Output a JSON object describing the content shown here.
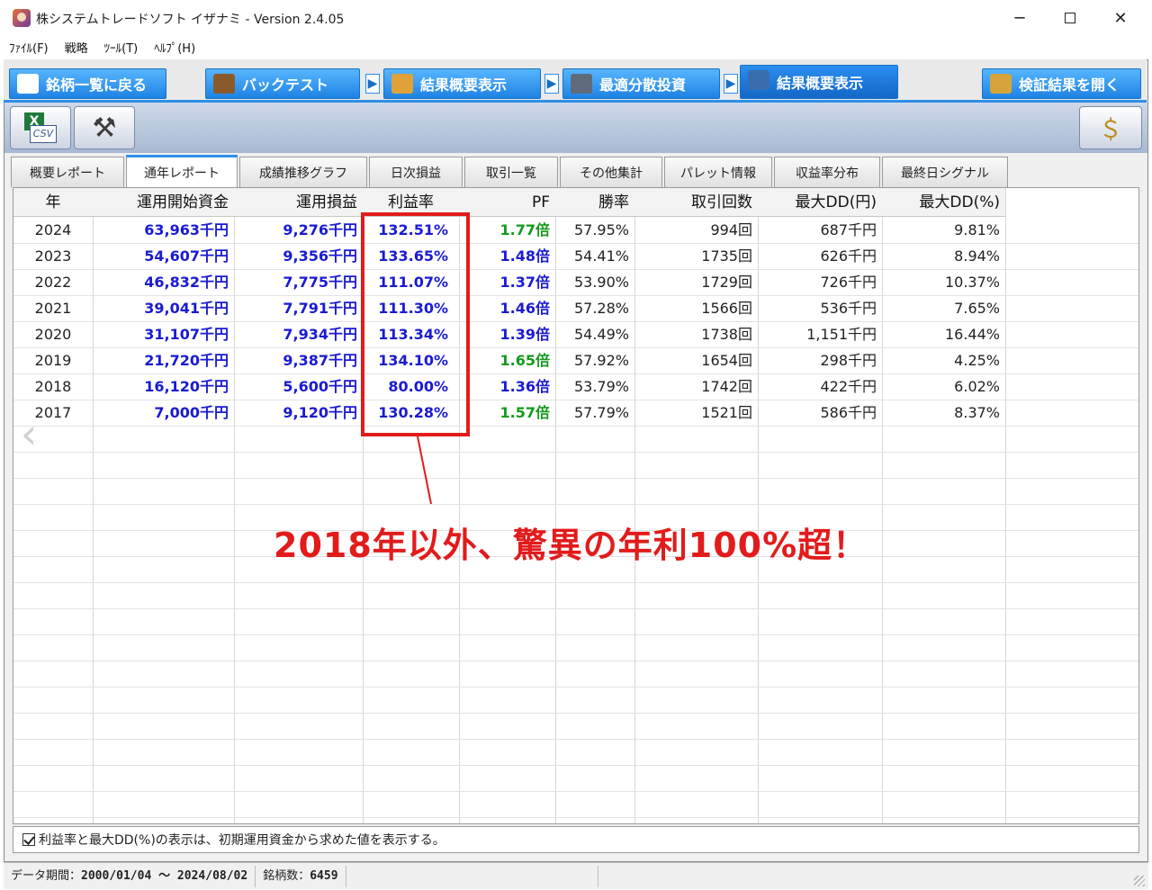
{
  "window": {
    "title": "株システムトレードソフト イザナミ - Version 2.4.05",
    "minimize": "─",
    "close": "✕"
  },
  "menu": [
    "ﾌｧｲﾙ(F)",
    "戦略",
    "ﾂｰﾙ(T)",
    "ﾍﾙﾌﾟ(H)"
  ],
  "nav": {
    "back_to_list": "銘柄一覧に戻る",
    "backtest": "バックテスト",
    "summary1": "結果概要表示",
    "optimal": "最適分散投資",
    "summary2": "結果概要表示",
    "open_results": "検証結果を開く"
  },
  "toolbar": {
    "csv_label": "CSV",
    "excel_label": "X"
  },
  "tabs": [
    "概要レポート",
    "通年レポート",
    "成績推移グラフ",
    "日次損益",
    "取引一覧",
    "その他集計",
    "パレット情報",
    "収益率分布",
    "最終日シグナル"
  ],
  "active_tab": "通年レポート",
  "table": {
    "headers": [
      "年",
      "運用開始資金",
      "運用損益",
      "利益率",
      "PF",
      "勝率",
      "取引回数",
      "最大DD(円)",
      "最大DD(%)"
    ],
    "rows": [
      [
        "2024",
        "63,963千円",
        "9,276千円",
        "132.51%",
        "1.77倍",
        "57.95%",
        "994回",
        "687千円",
        "9.81%"
      ],
      [
        "2023",
        "54,607千円",
        "9,356千円",
        "133.65%",
        "1.48倍",
        "54.41%",
        "1735回",
        "626千円",
        "8.94%"
      ],
      [
        "2022",
        "46,832千円",
        "7,775千円",
        "111.07%",
        "1.37倍",
        "53.90%",
        "1729回",
        "726千円",
        "10.37%"
      ],
      [
        "2021",
        "39,041千円",
        "7,791千円",
        "111.30%",
        "1.46倍",
        "57.28%",
        "1566回",
        "536千円",
        "7.65%"
      ],
      [
        "2020",
        "31,107千円",
        "7,934千円",
        "113.34%",
        "1.39倍",
        "54.49%",
        "1738回",
        "1,151千円",
        "16.44%"
      ],
      [
        "2019",
        "21,720千円",
        "9,387千円",
        "134.10%",
        "1.65倍",
        "57.92%",
        "1654回",
        "298千円",
        "4.25%"
      ],
      [
        "2018",
        "16,120千円",
        "5,600千円",
        "80.00%",
        "1.36倍",
        "53.79%",
        "1742回",
        "422千円",
        "6.02%"
      ],
      [
        "2017",
        "7,000千円",
        "9,120千円",
        "130.28%",
        "1.57倍",
        "57.79%",
        "1521回",
        "586千円",
        "8.37%"
      ]
    ],
    "pf_colors": [
      "green",
      "blue",
      "blue",
      "blue",
      "blue",
      "green",
      "blue",
      "green"
    ]
  },
  "annotation": "2018年以外、驚異の年利100%超！",
  "note": "利益率と最大DD(%)の表示は、初期運用資金から求めた値を表示する。",
  "status": {
    "period_label": "データ期間：",
    "period_value": "2000/01/04 〜 2024/08/02",
    "count_label": "銘柄数：",
    "count_value": "6459"
  },
  "colors": {
    "accent": "#2d8fe8",
    "annotation": "#e21b1b",
    "value_blue": "#1a1ad2",
    "value_green": "#139a1d"
  }
}
